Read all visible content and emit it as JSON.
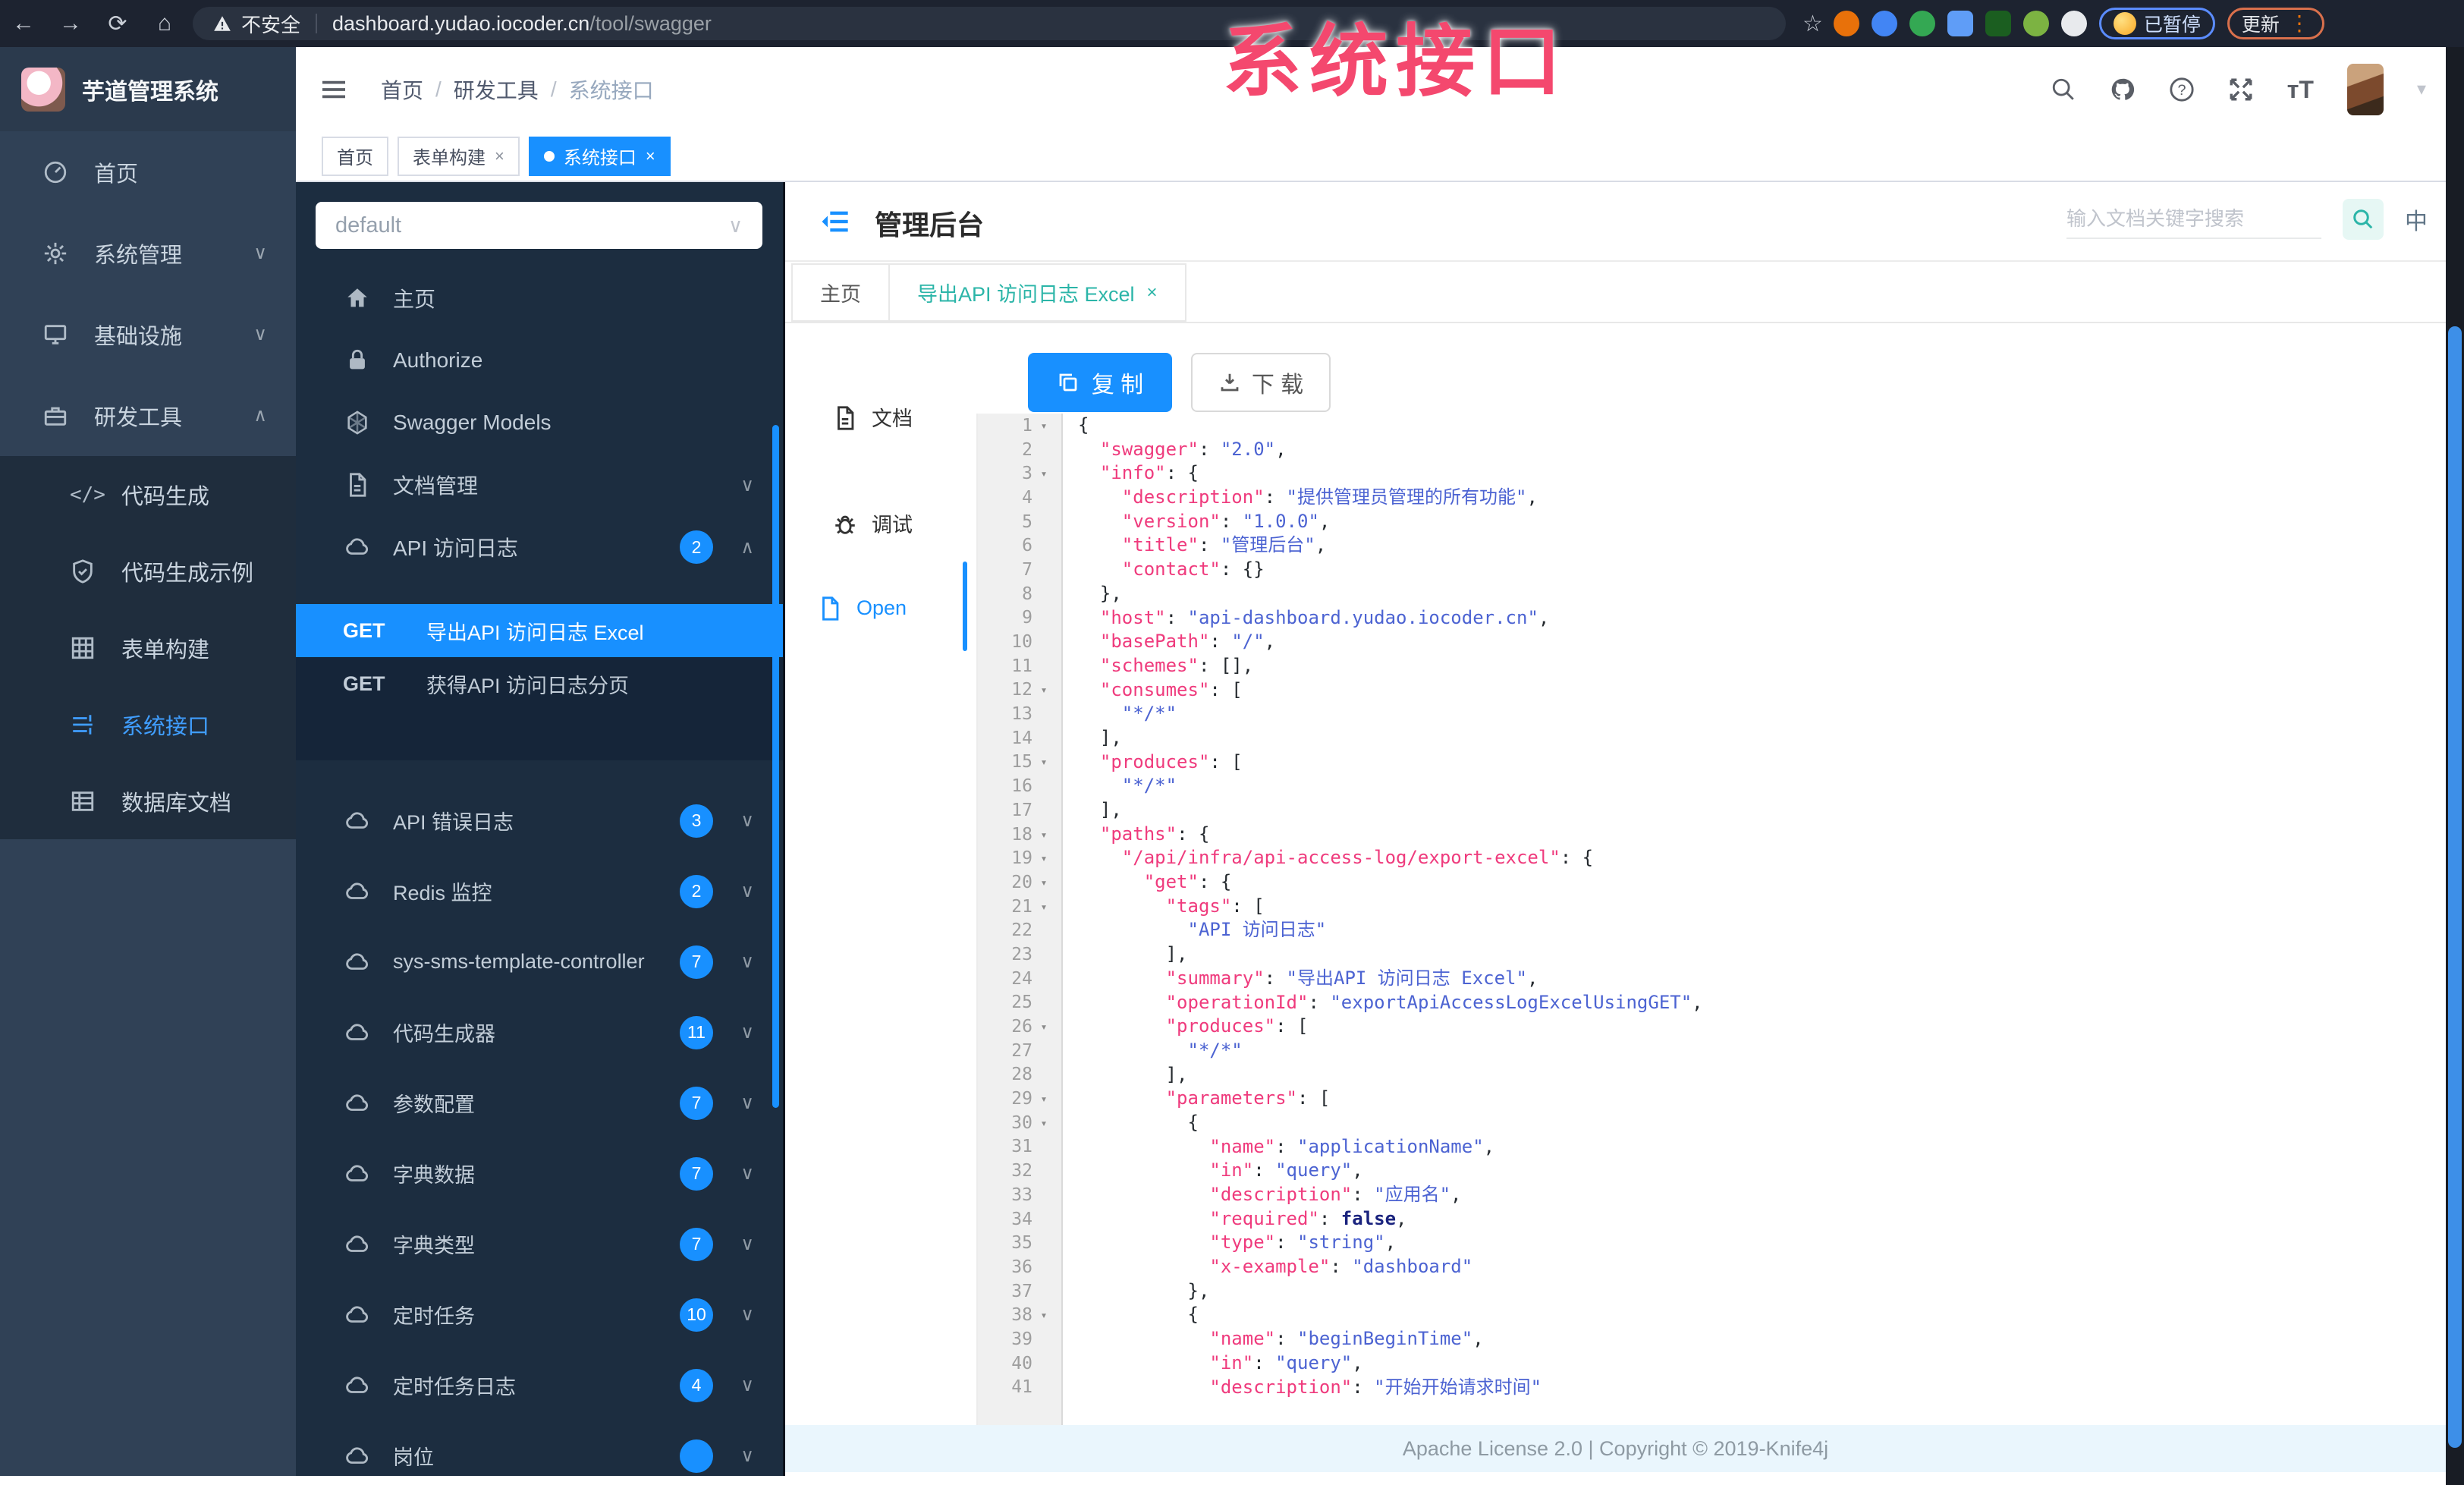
{
  "palette": {
    "accent": "#1890ff",
    "sidebar_active": "#409eff",
    "tag_active": "#1890ff",
    "code_key": "#ef3b7d",
    "code_string": "#4c63d2",
    "watermark": "#f4486e",
    "footer_bg": "#eaf6fd"
  },
  "browser": {
    "security_label": "不安全",
    "url_host": "dashboard.yudao.iocoder.cn",
    "url_path": "/tool/swagger",
    "paused_label": "已暂停",
    "update_label": "更新",
    "extensions": [
      {
        "icon": "orange-extension-icon",
        "color": "#e8710a",
        "shape": "circle"
      },
      {
        "icon": "blue-drop-extension-icon",
        "color": "#4285f4",
        "shape": "circle"
      },
      {
        "icon": "green-check-extension-icon",
        "color": "#34a853",
        "shape": "circle"
      },
      {
        "icon": "blue-grid-extension-icon",
        "color": "#5f9df7",
        "shape": "square"
      },
      {
        "icon": "dark-on-extension-icon",
        "color": "#1b5e20",
        "shape": "square"
      },
      {
        "icon": "green-leaf-extension-icon",
        "color": "#7cb342",
        "shape": "circle"
      },
      {
        "icon": "white-flower-extension-icon",
        "color": "#e8eaed",
        "shape": "circle"
      }
    ]
  },
  "watermark_text": "系统接口",
  "logo": {
    "title": "芋道管理系统"
  },
  "breadcrumb": [
    "首页",
    "研发工具",
    "系统接口"
  ],
  "tags_view": [
    {
      "label": "首页",
      "closable": false,
      "active": false
    },
    {
      "label": "表单构建",
      "closable": true,
      "active": false
    },
    {
      "label": "系统接口",
      "closable": true,
      "active": true
    }
  ],
  "sidebar": {
    "items": [
      {
        "label": "首页",
        "icon": "dashboard-icon",
        "chevron": null
      },
      {
        "label": "系统管理",
        "icon": "gear-icon",
        "chevron": "down"
      },
      {
        "label": "基础设施",
        "icon": "monitor-icon",
        "chevron": "down"
      },
      {
        "label": "研发工具",
        "icon": "toolbox-icon",
        "chevron": "up"
      }
    ],
    "sub_items": [
      {
        "label": "代码生成",
        "icon": "code-icon",
        "active": false
      },
      {
        "label": "代码生成示例",
        "icon": "shield-icon",
        "active": false
      },
      {
        "label": "表单构建",
        "icon": "grid-icon",
        "active": false
      },
      {
        "label": "系统接口",
        "icon": "api-list-icon",
        "active": true
      },
      {
        "label": "数据库文档",
        "icon": "table-icon",
        "active": false
      }
    ]
  },
  "swagger_panel": {
    "select_value": "default",
    "menu": [
      {
        "label": "主页",
        "icon": "home-icon",
        "chevron": null,
        "badge": null
      },
      {
        "label": "Authorize",
        "icon": "lock-icon",
        "chevron": null,
        "badge": null
      },
      {
        "label": "Swagger Models",
        "icon": "hexagon-icon",
        "chevron": null,
        "badge": null
      },
      {
        "label": "文档管理",
        "icon": "doc-icon",
        "chevron": "down",
        "badge": null
      },
      {
        "label": "API 访问日志",
        "icon": "cloud-icon",
        "chevron": "up",
        "badge": "2"
      }
    ],
    "operations": [
      {
        "method": "GET",
        "label": "导出API 访问日志 Excel",
        "active": true
      },
      {
        "method": "GET",
        "label": "获得API 访问日志分页",
        "active": false
      }
    ],
    "groups": [
      {
        "label": "API 错误日志",
        "icon": "cloud-icon",
        "badge": "3"
      },
      {
        "label": "Redis 监控",
        "icon": "cloud-icon",
        "badge": "2"
      },
      {
        "label": "sys-sms-template-controller",
        "icon": "cloud-icon",
        "badge": "7"
      },
      {
        "label": "代码生成器",
        "icon": "cloud-icon",
        "badge": "11"
      },
      {
        "label": "参数配置",
        "icon": "cloud-icon",
        "badge": "7"
      },
      {
        "label": "字典数据",
        "icon": "cloud-icon",
        "badge": "7"
      },
      {
        "label": "字典类型",
        "icon": "cloud-icon",
        "badge": "7"
      },
      {
        "label": "定时任务",
        "icon": "cloud-icon",
        "badge": "10"
      },
      {
        "label": "定时任务日志",
        "icon": "cloud-icon",
        "badge": "4"
      },
      {
        "label": "岗位",
        "icon": "cloud-icon",
        "badge": ""
      }
    ]
  },
  "doc_header": {
    "title": "管理后台",
    "search_placeholder": "输入文档关键字搜索",
    "lang_label": "中"
  },
  "doc_tabs": [
    {
      "label": "主页",
      "closable": false,
      "active": false
    },
    {
      "label": "导出API 访问日志 Excel",
      "closable": true,
      "active": true
    }
  ],
  "side_tabs": [
    {
      "label": "文档",
      "icon": "doc-icon",
      "active": false
    },
    {
      "label": "调试",
      "icon": "bug-icon",
      "active": false
    },
    {
      "label": "Open",
      "icon": "file-icon",
      "active": true
    }
  ],
  "toolbar": {
    "copy_label": "复 制",
    "download_label": "下 载"
  },
  "editor": {
    "fold_lines": [
      1,
      3,
      12,
      15,
      18,
      19,
      20,
      21,
      26,
      29,
      30,
      38
    ],
    "lines": [
      "{",
      "  \"swagger\": \"2.0\",",
      "  \"info\": {",
      "    \"description\": \"提供管理员管理的所有功能\",",
      "    \"version\": \"1.0.0\",",
      "    \"title\": \"管理后台\",",
      "    \"contact\": {}",
      "  },",
      "  \"host\": \"api-dashboard.yudao.iocoder.cn\",",
      "  \"basePath\": \"/\",",
      "  \"schemes\": [],",
      "  \"consumes\": [",
      "    \"*/*\"",
      "  ],",
      "  \"produces\": [",
      "    \"*/*\"",
      "  ],",
      "  \"paths\": {",
      "    \"/api/infra/api-access-log/export-excel\": {",
      "      \"get\": {",
      "        \"tags\": [",
      "          \"API 访问日志\"",
      "        ],",
      "        \"summary\": \"导出API 访问日志 Excel\",",
      "        \"operationId\": \"exportApiAccessLogExcelUsingGET\",",
      "        \"produces\": [",
      "          \"*/*\"",
      "        ],",
      "        \"parameters\": [",
      "          {",
      "            \"name\": \"applicationName\",",
      "            \"in\": \"query\",",
      "            \"description\": \"应用名\",",
      "            \"required\": false,",
      "            \"type\": \"string\",",
      "            \"x-example\": \"dashboard\"",
      "          },",
      "          {",
      "            \"name\": \"beginBeginTime\",",
      "            \"in\": \"query\",",
      "            \"description\": \"开始开始请求时间\""
    ]
  },
  "footer_text": "Apache License 2.0 | Copyright © 2019-Knife4j"
}
